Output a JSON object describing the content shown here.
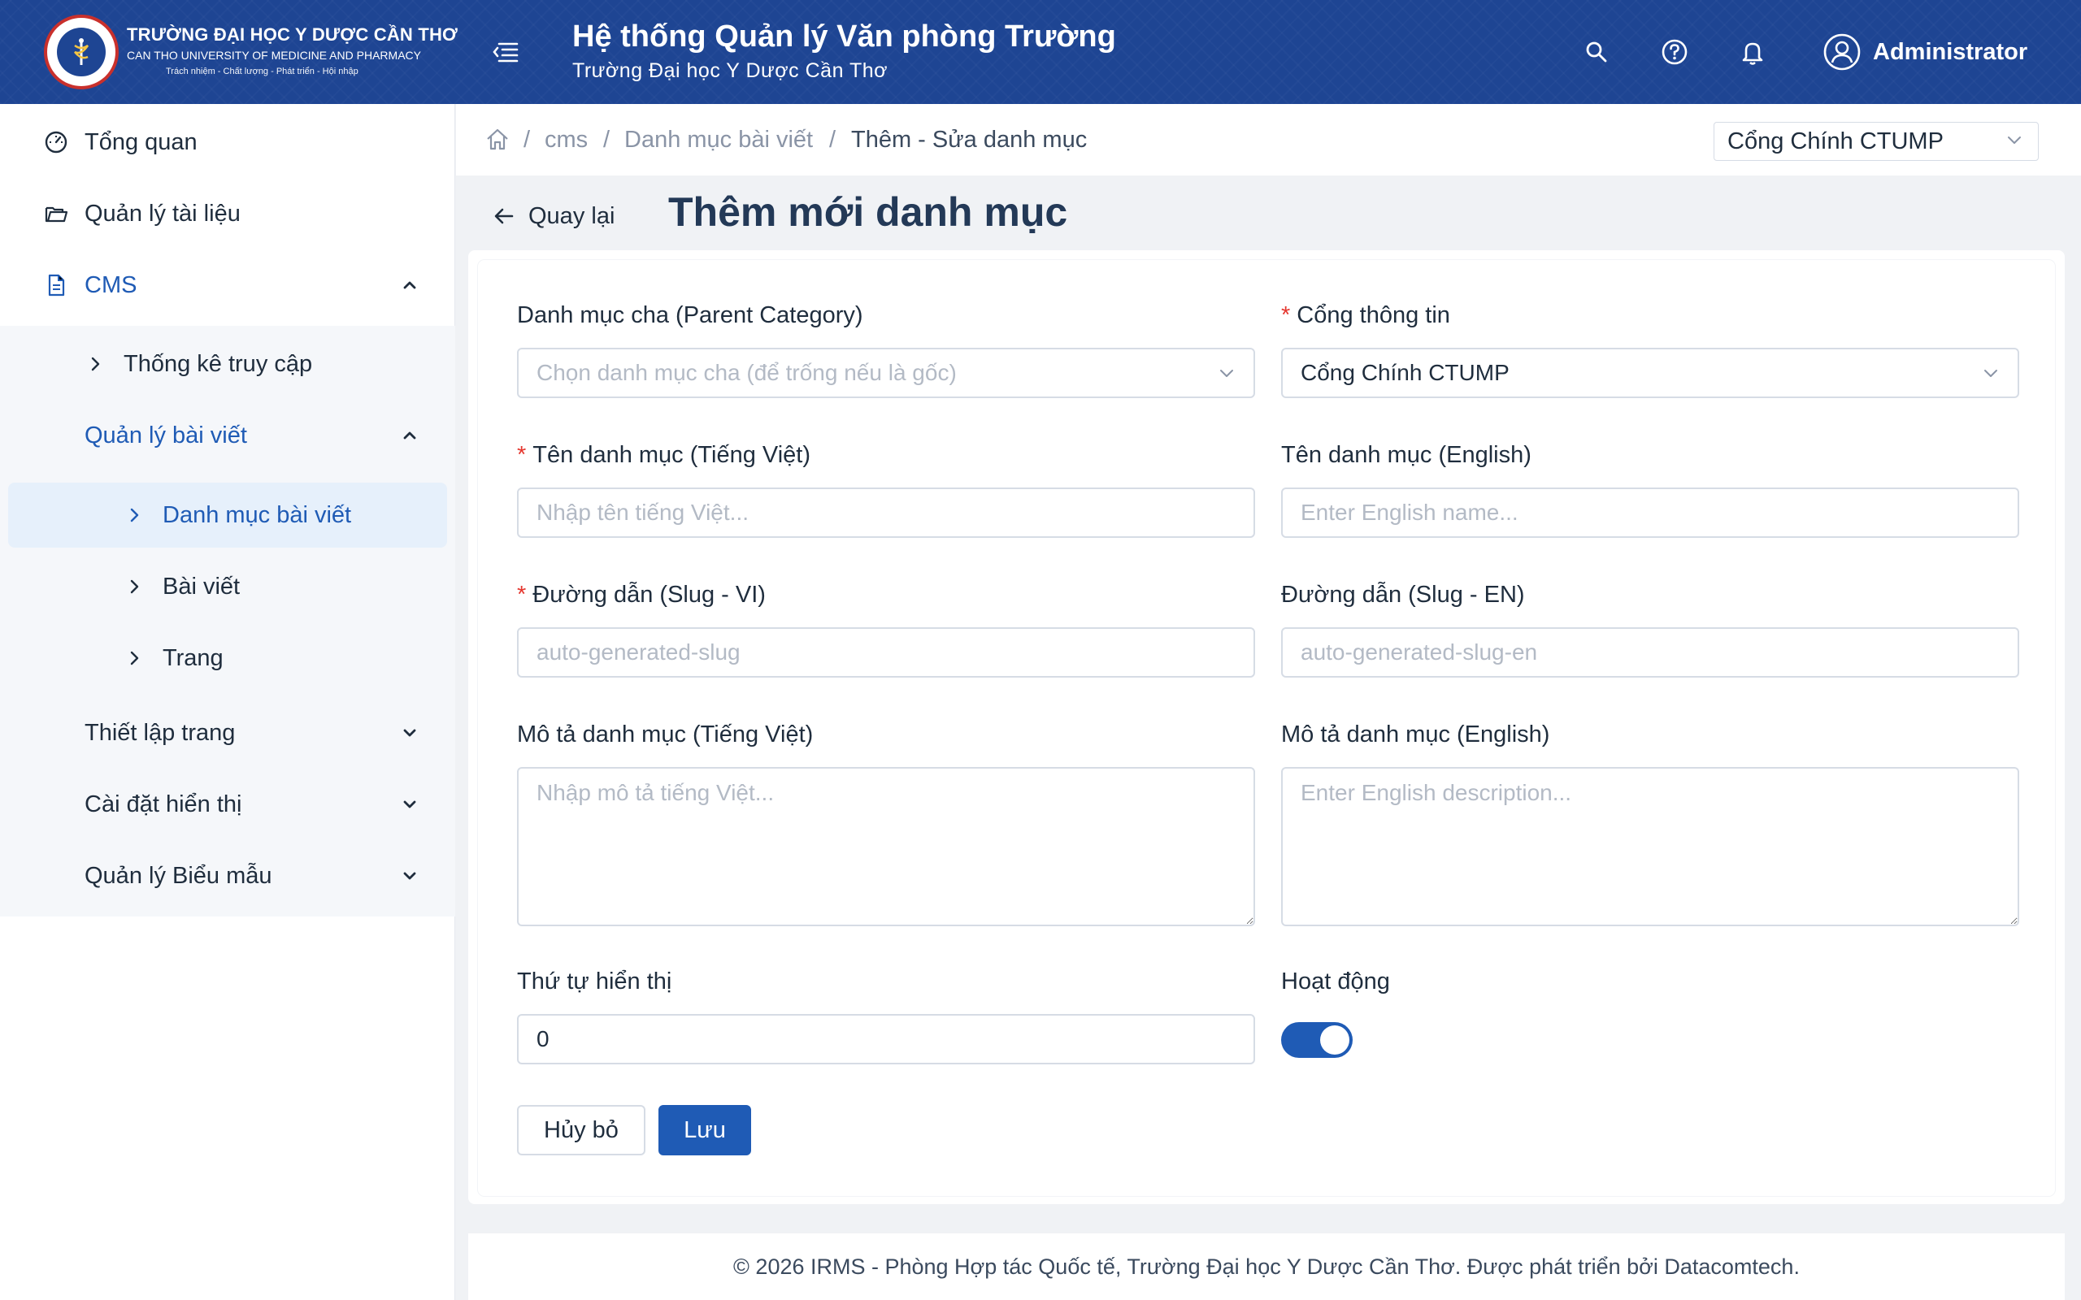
{
  "header": {
    "logo_title": "TRƯỜNG ĐẠI HỌC Y DƯỢC CẦN THƠ",
    "logo_subtitle": "CAN THO UNIVERSITY OF MEDICINE AND PHARMACY",
    "logo_motto": "Trách nhiệm - Chất lượng - Phát triển - Hội nhập",
    "system_title": "Hệ thống Quản lý Văn phòng Trường",
    "system_subtitle": "Trường Đại học Y Dược Cần Thơ",
    "user_name": "Administrator",
    "colors": {
      "header_bg": "#1e4593",
      "primary": "#1f5bb5",
      "required": "#e5372f"
    }
  },
  "sidebar": {
    "items": [
      {
        "label": "Tổng quan",
        "icon": "dashboard-icon"
      },
      {
        "label": "Quản lý tài liệu",
        "icon": "folder-icon"
      },
      {
        "label": "CMS",
        "icon": "document-icon",
        "expanded": true
      },
      {
        "label": "Thống kê truy cập"
      },
      {
        "label": "Quản lý bài viết",
        "expanded": true
      },
      {
        "label": "Danh mục bài viết",
        "active": true
      },
      {
        "label": "Bài viết"
      },
      {
        "label": "Trang"
      },
      {
        "label": "Thiết lập trang"
      },
      {
        "label": "Cài đặt hiển thị"
      },
      {
        "label": "Quản lý Biểu mẫu"
      }
    ]
  },
  "breadcrumb": {
    "items": [
      "cms",
      "Danh mục bài viết",
      "Thêm - Sửa danh mục"
    ],
    "separator": "/"
  },
  "portal_selector": {
    "value": "Cổng Chính CTUMP"
  },
  "page": {
    "back_label": "Quay lại",
    "title": "Thêm mới danh mục"
  },
  "form": {
    "parent_category": {
      "label": "Danh mục cha (Parent Category)",
      "placeholder": "Chọn danh mục cha (để trống nếu là gốc)"
    },
    "portal": {
      "label": "Cổng thông tin",
      "value": "Cổng Chính CTUMP",
      "required": true
    },
    "name_vi": {
      "label": "Tên danh mục (Tiếng Việt)",
      "placeholder": "Nhập tên tiếng Việt...",
      "required": true
    },
    "name_en": {
      "label": "Tên danh mục (English)",
      "placeholder": "Enter English name..."
    },
    "slug_vi": {
      "label": "Đường dẫn (Slug - VI)",
      "placeholder": "auto-generated-slug",
      "required": true
    },
    "slug_en": {
      "label": "Đường dẫn (Slug - EN)",
      "placeholder": "auto-generated-slug-en"
    },
    "desc_vi": {
      "label": "Mô tả danh mục (Tiếng Việt)",
      "placeholder": "Nhập mô tả tiếng Việt..."
    },
    "desc_en": {
      "label": "Mô tả danh mục (English)",
      "placeholder": "Enter English description..."
    },
    "order": {
      "label": "Thứ tự hiển thị",
      "value": "0"
    },
    "active": {
      "label": "Hoạt động",
      "checked": true
    },
    "cancel_label": "Hủy bỏ",
    "save_label": "Lưu"
  },
  "footer": {
    "text": "© 2026 IRMS - Phòng Hợp tác Quốc tế, Trường Đại học Y Dược Cần Thơ. Được phát triển bởi Datacomtech."
  }
}
